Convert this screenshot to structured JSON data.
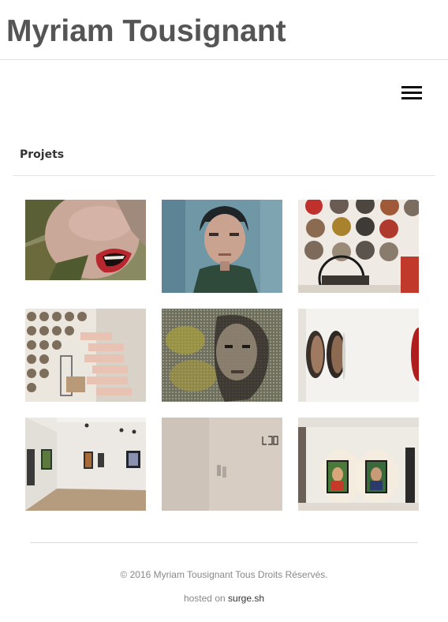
{
  "header": {
    "title": "Myriam Tousignant"
  },
  "nav": {
    "menu_icon": "hamburger-icon"
  },
  "projects": {
    "heading": "Projets",
    "thumbnails": [
      {
        "name": "open-mouth-portrait"
      },
      {
        "name": "young-man-portrait"
      },
      {
        "name": "round-portraits-wall"
      },
      {
        "name": "paper-roll-installation"
      },
      {
        "name": "woman-face-mesh"
      },
      {
        "name": "round-portraits-side"
      },
      {
        "name": "gallery-room-view"
      },
      {
        "name": "wall-lettering"
      },
      {
        "name": "two-framed-portraits"
      }
    ]
  },
  "footer": {
    "copyright": "© 2016 Myriam Tousignant Tous Droits Réservés.",
    "hosted_prefix": "hosted on",
    "hosted_link": "surge.sh"
  }
}
